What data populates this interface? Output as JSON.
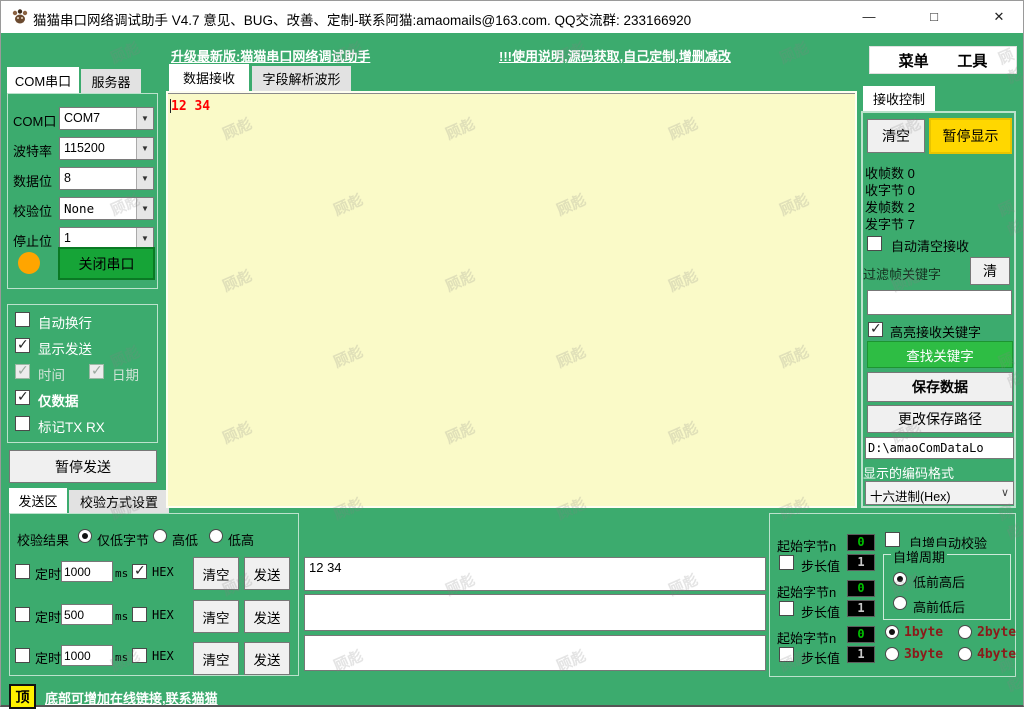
{
  "window": {
    "title": "猫猫串口网络调试助手 V4.7 意见、BUG、改善、定制-联系阿猫:amaomails@163.com. QQ交流群: 233166920",
    "minimize_icon": "—",
    "maximize_icon": "□",
    "close_icon": "✕"
  },
  "header": {
    "upgrade_link": "升级最新版:猫猫串口网络调试助手",
    "help_link": "!!!使用说明,源码获取,自己定制,增删减改",
    "menu_items": [
      "菜单",
      "工具"
    ]
  },
  "serial_panel": {
    "tabs": [
      "COM串口",
      "服务器"
    ],
    "active_tab": "COM串口",
    "fields": [
      {
        "label": "COM口",
        "value": "COM7"
      },
      {
        "label": "波特率",
        "value": "115200"
      },
      {
        "label": "数据位",
        "value": "8"
      },
      {
        "label": "校验位",
        "value": "None"
      },
      {
        "label": "停止位",
        "value": "1"
      }
    ],
    "status_light_color": "#FFA500",
    "close_serial_button": "关闭串口",
    "options": [
      {
        "label": "自动换行",
        "checked": false
      },
      {
        "label": "显示发送",
        "checked": true
      },
      {
        "label": "时间",
        "checked": true,
        "disabled": true
      },
      {
        "label": "日期",
        "checked": true,
        "disabled": true
      },
      {
        "label": "仅数据",
        "checked": true
      },
      {
        "label": "标记TX RX",
        "checked": false
      }
    ],
    "pause_send_button": "暂停发送"
  },
  "receive_view": {
    "tabs": [
      "数据接收",
      "字段解析波形"
    ],
    "active_tab": "数据接收",
    "content": "12 34",
    "content_color": "#FF0000",
    "background": "#FAFAC8"
  },
  "receive_control": {
    "tab": "接收控制",
    "clear_button": "清空",
    "pause_display_button": "暂停显示",
    "stats": [
      {
        "label": "收帧数",
        "value": "0"
      },
      {
        "label": "收字节",
        "value": "0"
      },
      {
        "label": "发帧数",
        "value": "2"
      },
      {
        "label": "发字节",
        "value": "7"
      }
    ],
    "auto_clear_checkbox": {
      "label": "自动清空接收",
      "checked": false
    },
    "filter_label": "过滤帧关键字",
    "filter_clear_button": "清",
    "filter_input_value": "",
    "highlight_checkbox": {
      "label": "高亮接收关键字",
      "checked": true
    },
    "find_keyword_button": "查找关键字",
    "save_data_button": "保存数据",
    "change_path_button": "更改保存路径",
    "save_path": "D:\\amaoComDataLo",
    "encoding_label": "显示的编码格式",
    "encoding_value": "十六进制(Hex)"
  },
  "send_area": {
    "tabs": [
      "发送区",
      "校验方式设置"
    ],
    "active_tab": "发送区",
    "checksum_label": "校验结果",
    "checksum_options": [
      {
        "label": "仅低字节",
        "selected": true
      },
      {
        "label": "高低",
        "selected": false
      },
      {
        "label": "低高",
        "selected": false
      }
    ],
    "rows": [
      {
        "timer_label": "定时",
        "interval": "1000",
        "unit": "ms",
        "hex_label": "HEX",
        "timer_checked": false,
        "hex_checked": true,
        "clear_button": "清空",
        "send_button": "发送",
        "input_value": "12 34"
      },
      {
        "timer_label": "定时",
        "interval": "500",
        "unit": "ms",
        "hex_label": "HEX",
        "timer_checked": false,
        "hex_checked": false,
        "clear_button": "清空",
        "send_button": "发送",
        "input_value": ""
      },
      {
        "timer_label": "定时",
        "interval": "1000",
        "unit": "ms",
        "hex_label": "HEX",
        "timer_checked": false,
        "hex_checked": false,
        "clear_button": "清空",
        "send_button": "发送",
        "input_value": ""
      }
    ],
    "increment": {
      "groups": [
        {
          "start_label": "起始字节n",
          "start_value": "0",
          "step_label": "步长值",
          "step_value": "1",
          "step_checked": false
        },
        {
          "start_label": "起始字节n",
          "start_value": "0",
          "step_label": "步长值",
          "step_value": "1",
          "step_checked": false
        },
        {
          "start_label": "起始字节n",
          "start_value": "0",
          "step_label": "步长值",
          "step_value": "1",
          "step_checked": false
        }
      ],
      "auto_check_checkbox": {
        "label": "自增自动校验",
        "checked": false
      },
      "cycle_group_label": "自增周期",
      "cycle_options": [
        {
          "label": "低前高后",
          "selected": true
        },
        {
          "label": "高前低后",
          "selected": false
        }
      ],
      "byte_options": [
        {
          "label": "1byte",
          "selected": true
        },
        {
          "label": "2byte",
          "selected": false
        },
        {
          "label": "3byte",
          "selected": false
        },
        {
          "label": "4byte",
          "selected": false
        }
      ]
    }
  },
  "footer": {
    "top_button": "顶",
    "link": "底部可增加在线链接,联系猫猫"
  },
  "watermark": "顾彪",
  "colors": {
    "background_green": "#3CAB6E",
    "gold": "#FFD700",
    "receive_bg": "#FAFAC8",
    "receive_text": "#FF0000",
    "find_button_green": "#2EBD44",
    "close_serial_green": "#16A437",
    "top_button_yellow": "#FFF100",
    "value_box_digit_green": "#00C000",
    "byte_label_red": "#8B1A1A"
  }
}
